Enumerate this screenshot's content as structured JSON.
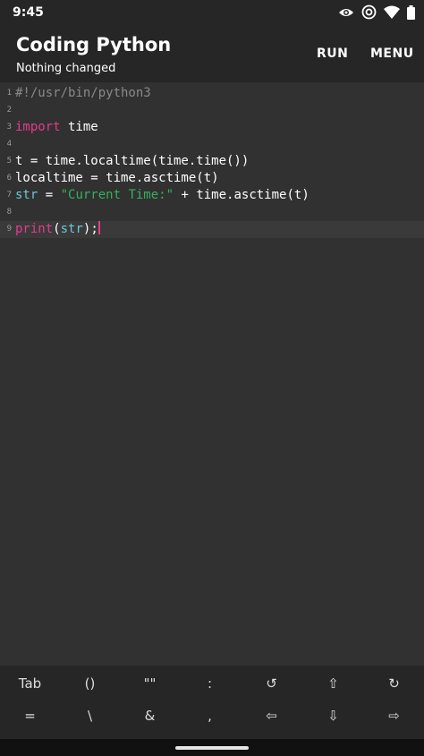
{
  "status": {
    "time": "9:45",
    "icons": [
      "eye-icon",
      "hotspot-icon",
      "wifi-icon",
      "battery-icon"
    ]
  },
  "app_bar": {
    "title": "Coding Python",
    "subtitle": "Nothing changed",
    "run_label": "RUN",
    "menu_label": "MENU"
  },
  "editor": {
    "lines": [
      {
        "no": "1",
        "text": "#!/usr/bin/python3"
      },
      {
        "no": "2",
        "text": ""
      },
      {
        "no": "3",
        "text": "import time"
      },
      {
        "no": "4",
        "text": ""
      },
      {
        "no": "5",
        "text": "t = time.localtime(time.time())"
      },
      {
        "no": "6",
        "text": "localtime = time.asctime(t)"
      },
      {
        "no": "7",
        "text": "str = \"Current Time:\" + time.asctime(t)"
      },
      {
        "no": "8",
        "text": ""
      },
      {
        "no": "9",
        "text": "print(str);"
      }
    ],
    "tokens": {
      "l1": "#!/usr/bin/python3",
      "l3_kw": "import",
      "l3_rest": " time",
      "l5": "t = time.localtime(time.time())",
      "l6": "localtime = time.asctime(t)",
      "l7_ident": "str",
      "l7_eq": " = ",
      "l7_str": "\"Current Time:\"",
      "l7_rest": " + time.asctime(t)",
      "l9_kw": "print",
      "l9_p1": "(",
      "l9_ident": "str",
      "l9_p2": ");"
    }
  },
  "helper_keys": {
    "row1": [
      "Tab",
      "()",
      "\"\"",
      ":",
      "↺",
      "⇧",
      "↻"
    ],
    "row2": [
      "=",
      "\\",
      "&",
      ",",
      "⇦",
      "⇩",
      "⇨"
    ]
  },
  "colors": {
    "background": "#313131",
    "bar": "#262626",
    "keyword": "#e53b8c",
    "string": "#36b05e",
    "identifier": "#6dc7d6",
    "comment": "#8a8a8a"
  }
}
